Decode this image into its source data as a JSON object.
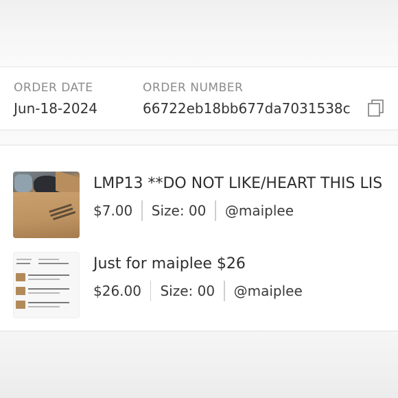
{
  "order": {
    "date_label": "ORDER DATE",
    "date_value": "Jun-18-2024",
    "number_label": "ORDER NUMBER",
    "number_value": "66722eb18bb677da7031538c"
  },
  "items": [
    {
      "title": "LMP13 **DO NOT LIKE/HEART THIS LIS",
      "price": "$7.00",
      "size": "Size: 00",
      "seller": "@maiplee",
      "thumbnail_icon": "cardboard-box-photo"
    },
    {
      "title": "Just for maiplee $26",
      "price": "$26.00",
      "size": "Size: 00",
      "seller": "@maiplee",
      "thumbnail_icon": "order-screenshot-photo"
    }
  ],
  "icons": {
    "copy": "copy-icon"
  }
}
